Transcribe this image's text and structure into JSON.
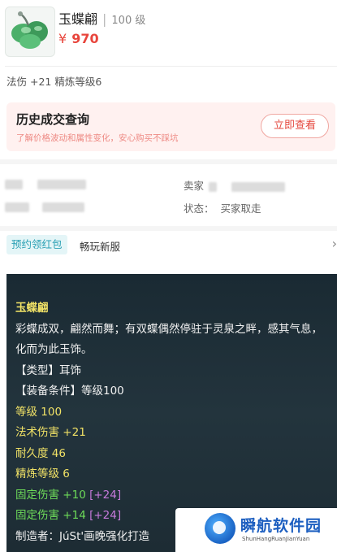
{
  "item": {
    "name": "玉蝶翩",
    "level": "100 级",
    "price_symbol": "¥",
    "price": "970",
    "stats": "法伤 +21 精炼等级6"
  },
  "history": {
    "title": "历史成交查询",
    "subtitle": "了解价格波动和属性变化，安心购买不踩坑",
    "button": "立即查看"
  },
  "trade_info": {
    "seller_label": "卖家",
    "status_label": "状态：",
    "status_value": "买家取走"
  },
  "promo": {
    "tag": "预约领红包",
    "server": "畅玩新服",
    "arrow": "›"
  },
  "description": {
    "name": "玉蝶翩",
    "flavor": "彩蝶成双，翩然而舞；有双蝶偶然停驻于灵泉之畔，感其气息，化而为此玉饰。",
    "type": "【类型】耳饰",
    "requirement": "【装备条件】等级100",
    "level": "等级 100",
    "magic_damage": "法术伤害 +21",
    "durability": "耐久度 46",
    "refine": "精炼等级 6",
    "fixed1_label": "固定伤害 +10",
    "fixed1_bonus": "[+24]",
    "fixed2_label": "固定伤害 +14",
    "fixed2_bonus": "[+24]",
    "maker": "制造者：JúSt'画晚强化打造"
  },
  "watermark": {
    "title": "瞬航软件园",
    "subtitle": "ShunHangRuanJianYuan"
  },
  "colors": {
    "price": "#e8453c",
    "accent_red": "#e5483f",
    "panel_bg": "#1f2f38",
    "yellow_text": "#f1e266",
    "green_text": "#6edc59",
    "purple_text": "#c77adc",
    "tag_blue": "#2aa0b4"
  }
}
